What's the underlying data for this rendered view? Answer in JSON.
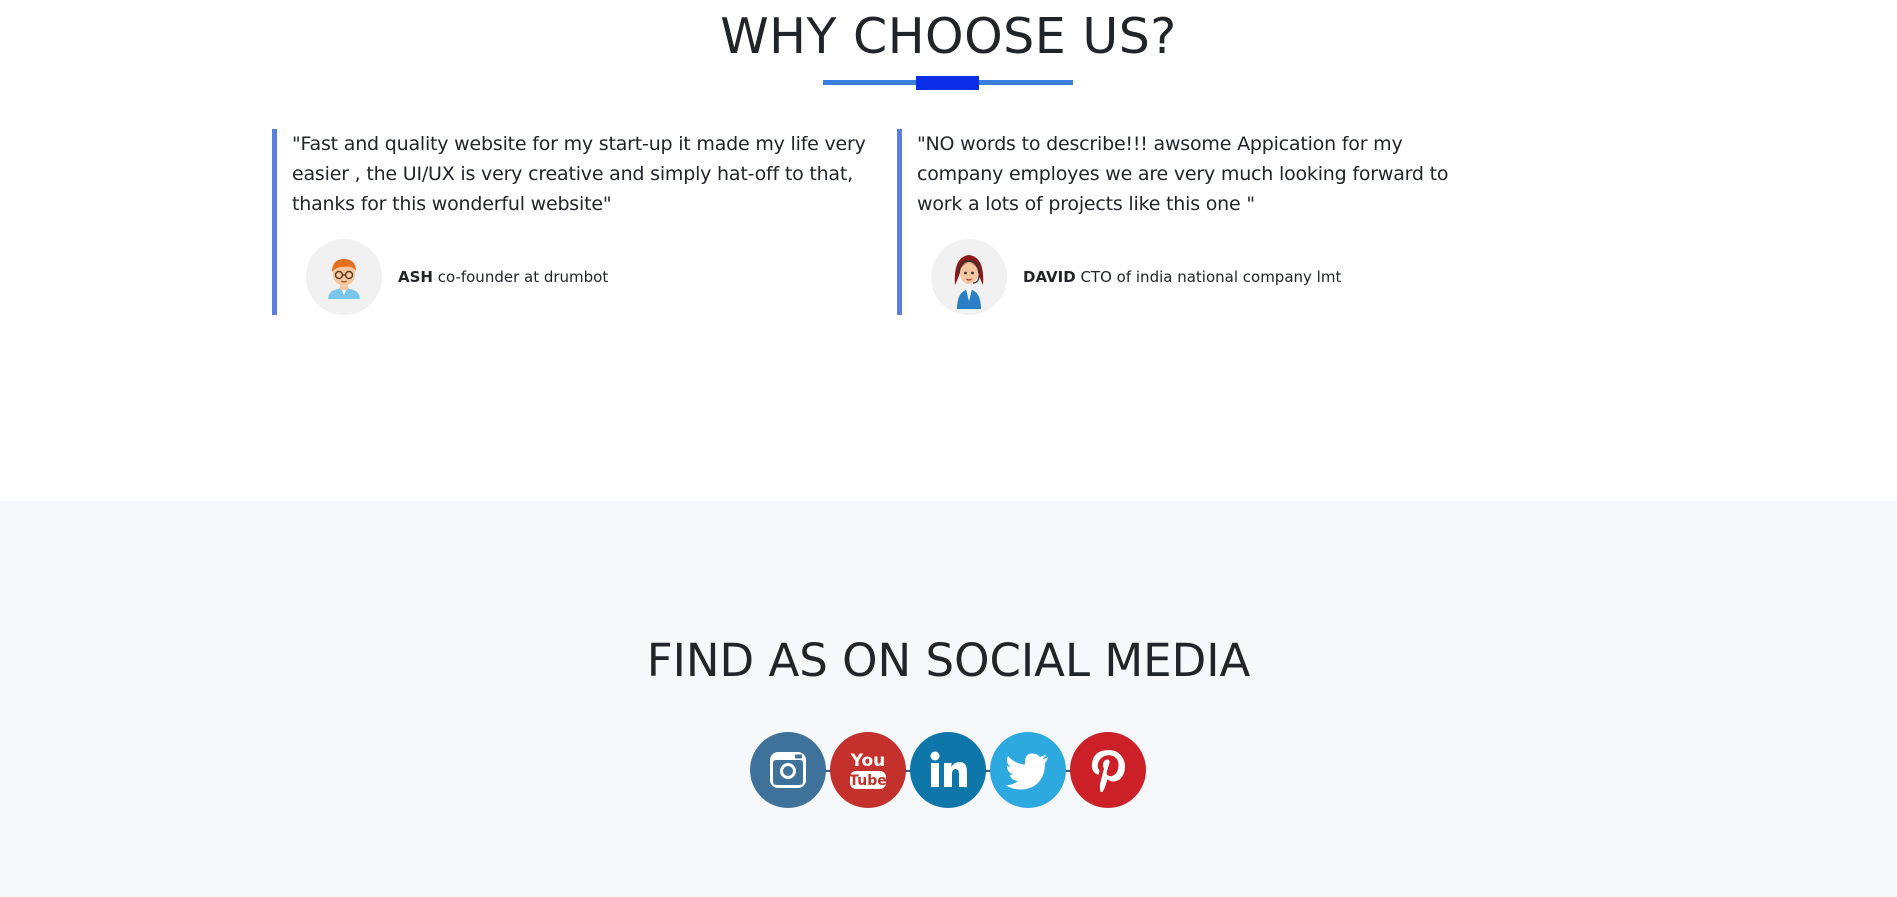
{
  "testimonials": {
    "title": "WHY CHOOSE US?",
    "items": [
      {
        "quote": "\"Fast and quality website for my start-up it made my life very easier , the UI/UX is very creative and simply hat-off to that, thanks for this wonderful website\"",
        "name": "ASH",
        "role": " co-founder at drumbot",
        "avatar_icon": "man-with-glasses-icon"
      },
      {
        "quote": "\"NO words to describe!!! awsome Appication for my company employes we are very much looking forward to work a lots of projects like this one \"",
        "name": "DAVID",
        "role": " CTO of india national company lmt",
        "avatar_icon": "woman-with-headset-icon"
      }
    ]
  },
  "social": {
    "title": "FIND AS ON SOCIAL MEDIA",
    "links": [
      {
        "network": "Instagram",
        "icon": "instagram-icon",
        "color": "#3f729b"
      },
      {
        "network": "YouTube",
        "icon": "youtube-icon",
        "color": "#c4302b",
        "logo_text_top": "You",
        "logo_text_bottom": "Tube"
      },
      {
        "network": "LinkedIn",
        "icon": "linkedin-icon",
        "color": "#0e76a8"
      },
      {
        "network": "Twitter",
        "icon": "twitter-icon",
        "color": "#2ea9df"
      },
      {
        "network": "Pinterest",
        "icon": "pinterest-icon",
        "color": "#cb2027"
      }
    ]
  },
  "colors": {
    "accent_blue": "#0a2ee8",
    "underline_blue": "#3b7ddd",
    "testimonial_border": "#5b7fde",
    "social_bg": "#f7f8fa"
  }
}
